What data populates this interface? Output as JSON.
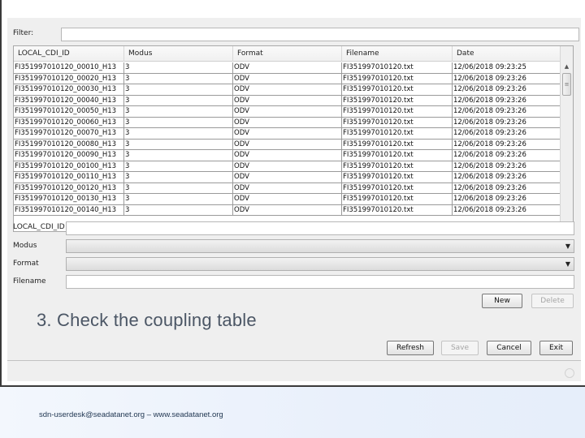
{
  "filter": {
    "label": "Filter:",
    "value": ""
  },
  "table": {
    "columns": [
      "LOCAL_CDI_ID",
      "Modus",
      "Format",
      "Filename",
      "Date"
    ],
    "rows": [
      [
        "FI351997010120_00010_H13",
        "3",
        "ODV",
        "FI351997010120.txt",
        "12/06/2018 09:23:25"
      ],
      [
        "FI351997010120_00020_H13",
        "3",
        "ODV",
        "FI351997010120.txt",
        "12/06/2018 09:23:26"
      ],
      [
        "FI351997010120_00030_H13",
        "3",
        "ODV",
        "FI351997010120.txt",
        "12/06/2018 09:23:26"
      ],
      [
        "FI351997010120_00040_H13",
        "3",
        "ODV",
        "FI351997010120.txt",
        "12/06/2018 09:23:26"
      ],
      [
        "FI351997010120_00050_H13",
        "3",
        "ODV",
        "FI351997010120.txt",
        "12/06/2018 09:23:26"
      ],
      [
        "FI351997010120_00060_H13",
        "3",
        "ODV",
        "FI351997010120.txt",
        "12/06/2018 09:23:26"
      ],
      [
        "FI351997010120_00070_H13",
        "3",
        "ODV",
        "FI351997010120.txt",
        "12/06/2018 09:23:26"
      ],
      [
        "FI351997010120_00080_H13",
        "3",
        "ODV",
        "FI351997010120.txt",
        "12/06/2018 09:23:26"
      ],
      [
        "FI351997010120_00090_H13",
        "3",
        "ODV",
        "FI351997010120.txt",
        "12/06/2018 09:23:26"
      ],
      [
        "FI351997010120_00100_H13",
        "3",
        "ODV",
        "FI351997010120.txt",
        "12/06/2018 09:23:26"
      ],
      [
        "FI351997010120_00110_H13",
        "3",
        "ODV",
        "FI351997010120.txt",
        "12/06/2018 09:23:26"
      ],
      [
        "FI351997010120_00120_H13",
        "3",
        "ODV",
        "FI351997010120.txt",
        "12/06/2018 09:23:26"
      ],
      [
        "FI351997010120_00130_H13",
        "3",
        "ODV",
        "FI351997010120.txt",
        "12/06/2018 09:23:26"
      ],
      [
        "FI351997010120_00140_H13",
        "3",
        "ODV",
        "FI351997010120.txt",
        "12/06/2018 09:23:26"
      ]
    ],
    "scroll_up": "▲",
    "scroll_down": "▼",
    "scroll_grip": "≡"
  },
  "form": {
    "local_cdi_id": {
      "label": "LOCAL_CDI_ID",
      "value": ""
    },
    "modus": {
      "label": "Modus",
      "value": ""
    },
    "format": {
      "label": "Format",
      "value": ""
    },
    "filename": {
      "label": "Filename",
      "value": ""
    },
    "combo_arrow": "▼"
  },
  "buttons": {
    "new": "New",
    "delete": "Delete",
    "refresh": "Refresh",
    "save": "Save",
    "cancel": "Cancel",
    "exit": "Exit"
  },
  "caption": "3. Check the coupling table",
  "footer": "sdn-userdesk@seadatanet.org – www.seadatanet.org"
}
